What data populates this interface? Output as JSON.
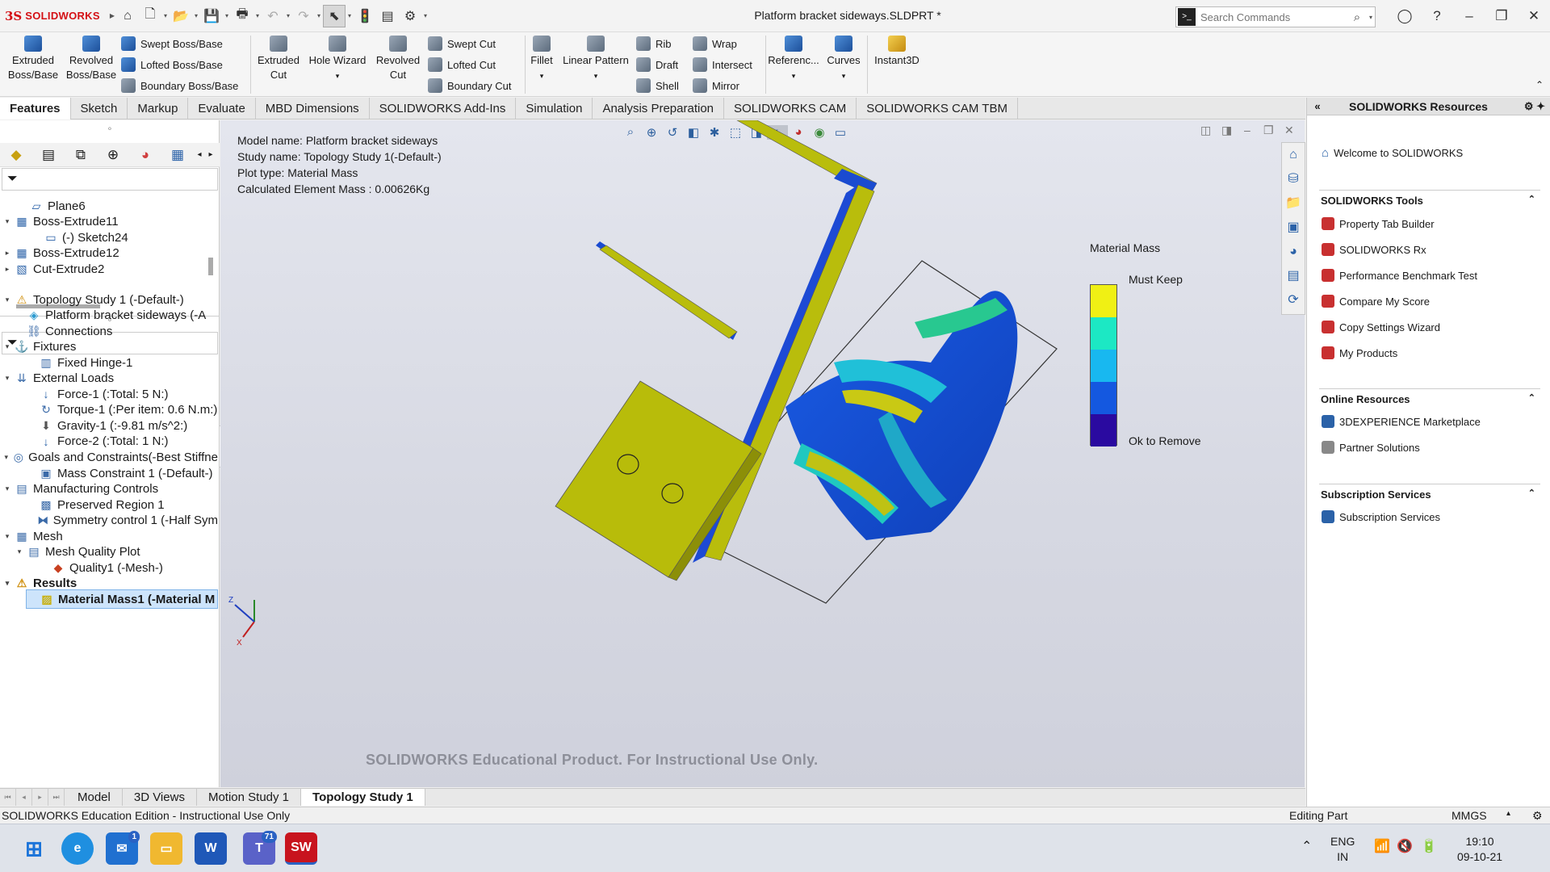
{
  "app": {
    "logo_ds": "3S",
    "logo_brand": "SOLIDWORKS",
    "document_title": "Platform bracket sideways.SLDPRT *",
    "search_placeholder": "Search Commands"
  },
  "commands": {
    "extruded_boss": [
      "Extruded",
      "Boss/Base"
    ],
    "revolved_boss": [
      "Revolved",
      "Boss/Base"
    ],
    "swept_boss": "Swept Boss/Base",
    "lofted_boss": "Lofted Boss/Base",
    "boundary_boss": "Boundary Boss/Base",
    "extruded_cut": [
      "Extruded",
      "Cut"
    ],
    "hole_wizard": "Hole Wizard",
    "revolved_cut": [
      "Revolved",
      "Cut"
    ],
    "swept_cut": "Swept Cut",
    "lofted_cut": "Lofted Cut",
    "boundary_cut": "Boundary Cut",
    "fillet": "Fillet",
    "linear_pattern": "Linear Pattern",
    "rib": "Rib",
    "draft": "Draft",
    "shell": "Shell",
    "wrap": "Wrap",
    "intersect": "Intersect",
    "mirror": "Mirror",
    "reference": "Referenc...",
    "curves": "Curves",
    "instant3d": "Instant3D"
  },
  "tabs": [
    "Features",
    "Sketch",
    "Markup",
    "Evaluate",
    "MBD Dimensions",
    "SOLIDWORKS Add-Ins",
    "Simulation",
    "Analysis Preparation",
    "SOLIDWORKS CAM",
    "SOLIDWORKS CAM TBM"
  ],
  "feature_tree": [
    {
      "label": "Plane6",
      "indent": 1,
      "exp": "",
      "icon": "plane-icon"
    },
    {
      "label": "Boss-Extrude11",
      "indent": 0,
      "exp": "▾",
      "icon": "extrude-icon"
    },
    {
      "label": "(-) Sketch24",
      "indent": 2,
      "exp": "",
      "icon": "sketch-icon"
    },
    {
      "label": "Boss-Extrude12",
      "indent": 0,
      "exp": "▸",
      "icon": "extrude-icon"
    },
    {
      "label": "Cut-Extrude2",
      "indent": 0,
      "exp": "▸",
      "icon": "cut-icon"
    }
  ],
  "study_tree": [
    {
      "label": "Topology Study 1 (-Default-)",
      "level": 0,
      "exp": "▾",
      "icon": "warning-icon"
    },
    {
      "label": "Platform bracket sideways (-A",
      "level": 1,
      "exp": "",
      "icon": "part-icon"
    },
    {
      "label": "Connections",
      "level": 1,
      "exp": "",
      "icon": "connections-icon"
    },
    {
      "label": "Fixtures",
      "level": 0,
      "exp": "▾",
      "icon": "fixtures-icon"
    },
    {
      "label": "Fixed Hinge-1",
      "level": 2,
      "exp": "",
      "icon": "hinge-icon"
    },
    {
      "label": "External Loads",
      "level": 0,
      "exp": "▾",
      "icon": "loads-icon"
    },
    {
      "label": "Force-1 (:Total: 5 N:)",
      "level": 2,
      "exp": "",
      "icon": "force-icon"
    },
    {
      "label": "Torque-1 (:Per item: 0.6 N.m:)",
      "level": 2,
      "exp": "",
      "icon": "torque-icon"
    },
    {
      "label": "Gravity-1 (:-9.81 m/s^2:)",
      "level": 2,
      "exp": "",
      "icon": "gravity-icon"
    },
    {
      "label": "Force-2 (:Total: 1 N:)",
      "level": 2,
      "exp": "",
      "icon": "force-icon"
    },
    {
      "label": "Goals and Constraints(-Best Stiffne",
      "level": 0,
      "exp": "▾",
      "icon": "goals-icon"
    },
    {
      "label": "Mass Constraint 1 (-Default-)",
      "level": 2,
      "exp": "",
      "icon": "constraint-icon"
    },
    {
      "label": "Manufacturing Controls",
      "level": 0,
      "exp": "▾",
      "icon": "manufacturing-icon"
    },
    {
      "label": "Preserved Region 1",
      "level": 2,
      "exp": "",
      "icon": "region-icon"
    },
    {
      "label": "Symmetry control 1 (-Half Sym",
      "level": 2,
      "exp": "",
      "icon": "symmetry-icon"
    },
    {
      "label": "Mesh",
      "level": 0,
      "exp": "▾",
      "icon": "mesh-icon"
    },
    {
      "label": "Mesh Quality Plot",
      "level": 1,
      "exp": "▾",
      "icon": "folder-icon"
    },
    {
      "label": "Quality1 (-Mesh-)",
      "level": 3,
      "exp": "",
      "icon": "quality-icon"
    },
    {
      "label": "Results",
      "level": 0,
      "exp": "▾",
      "icon": "results-icon",
      "bold": true
    },
    {
      "label": "Material Mass1 (-Material M",
      "level": 2,
      "exp": "",
      "icon": "plot-icon",
      "selected": true
    }
  ],
  "gfx": {
    "model_name": "Model name: Platform bracket sideways",
    "study_name": "Study name: Topology Study 1(-Default-)",
    "plot_type": "Plot type: Material Mass",
    "mass": "Calculated Element Mass :  0.00626Kg",
    "legend_title": "Material Mass",
    "legend_max": "Must Keep",
    "legend_min": "Ok to Remove",
    "legend_colors": [
      "#f0f014",
      "#1ce8c4",
      "#18b8f0",
      "#1458e0",
      "#2a0aa0"
    ],
    "watermark": "SOLIDWORKS Educational Product. For Instructional Use Only.",
    "triad_z": "Z",
    "triad_x": "X"
  },
  "taskpane": {
    "title": "SOLIDWORKS Resources",
    "welcome": "Welcome to SOLIDWORKS",
    "tools_header": "SOLIDWORKS Tools",
    "tools": [
      "Property Tab Builder",
      "SOLIDWORKS Rx",
      "Performance Benchmark Test",
      "Compare My Score",
      "Copy Settings Wizard",
      "My Products"
    ],
    "online_header": "Online Resources",
    "online": [
      "3DEXPERIENCE Marketplace",
      "Partner Solutions"
    ],
    "subscription_header": "Subscription Services",
    "subscription": [
      "Subscription Services"
    ]
  },
  "bottom_tabs": [
    "Model",
    "3D Views",
    "Motion Study 1",
    "Topology Study 1"
  ],
  "status": {
    "left": "SOLIDWORKS Education Edition - Instructional Use Only",
    "mode": "Editing Part",
    "units": "MMGS"
  },
  "taskbar": {
    "mail_badge": "1",
    "teams_badge": "71",
    "sw_label": "SW",
    "lang": "ENG",
    "region": "IN",
    "time": "19:10",
    "date": "09-10-21"
  }
}
